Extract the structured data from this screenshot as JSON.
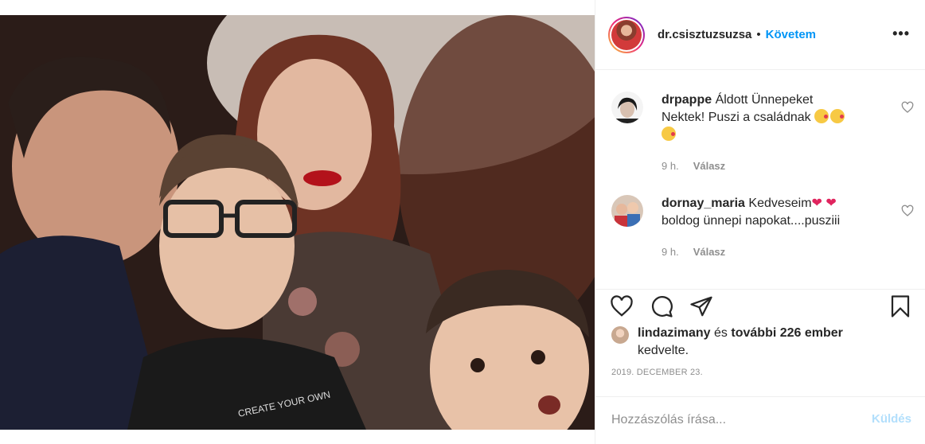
{
  "post": {
    "author": "dr.csisztuzsuzsa",
    "separator": "•",
    "follow_label": "Követem",
    "more_label": "•••"
  },
  "comments": [
    {
      "user": "drpappe",
      "text_1": "Áldott Ünnepeket",
      "text_2": "Nektek! Puszi a családnak",
      "time": "9 h.",
      "reply_label": "Válasz"
    },
    {
      "user": "dornay_maria",
      "text_1": "Kedveseim",
      "text_2": "boldog ünnepi napokat....pusziii",
      "time": "9 h.",
      "reply_label": "Válasz"
    }
  ],
  "likes": {
    "user": "lindazimany",
    "connector": "és",
    "others": "további 226 ember",
    "suffix": "kedvelte."
  },
  "date": "2019. DECEMBER 23.",
  "composer": {
    "placeholder": "Hozzászólás írása...",
    "send_label": "Küldés"
  },
  "colors": {
    "accent": "#0095f6",
    "send_disabled": "#b2dffc",
    "muted": "#8e8e8e",
    "border": "#efefef"
  },
  "icons": [
    "heart-icon",
    "comment-icon",
    "share-icon",
    "bookmark-icon",
    "more-icon"
  ]
}
